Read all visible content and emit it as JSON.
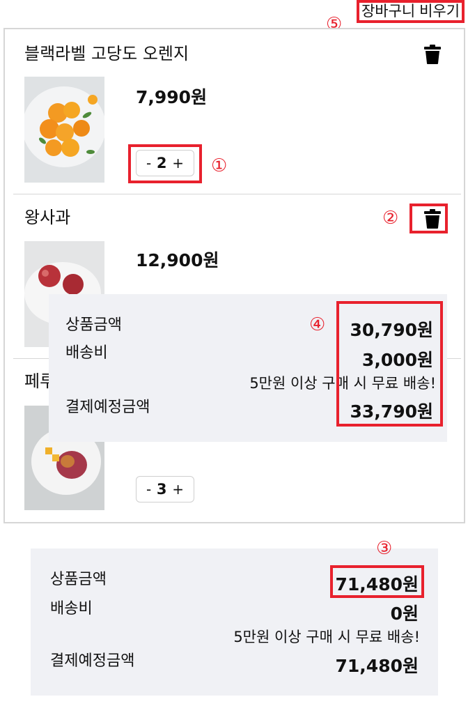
{
  "header": {
    "clear_cart_label": "장바구니 비우기"
  },
  "annotations": {
    "n1": "①",
    "n2": "②",
    "n3": "③",
    "n4": "④",
    "n5": "⑤"
  },
  "items": [
    {
      "name": "블랙라벨 고당도 오렌지",
      "price": "7,990원",
      "qty": "2",
      "minus": "-",
      "plus": "+"
    },
    {
      "name": "왕사과",
      "price": "12,900원"
    },
    {
      "name": "페루",
      "qty": "3",
      "minus": "-",
      "plus": "+"
    }
  ],
  "popup_summary": {
    "product_label": "상품금액",
    "product_value": "30,790원",
    "shipping_label": "배송비",
    "shipping_value": "3,000원",
    "free_note": "5만원 이상 구매 시 무료 배송!",
    "total_label": "결제예정금액",
    "total_value": "33,790원"
  },
  "bottom_summary": {
    "product_label": "상품금액",
    "product_value": "71,480원",
    "shipping_label": "배송비",
    "shipping_value": "0원",
    "free_note": "5만원 이상 구매 시 무료 배송!",
    "total_label": "결제예정금액",
    "total_value": "71,480원"
  },
  "colors": {
    "highlight": "#e8212d",
    "summary_bg": "#f0f1f5",
    "border": "#d6d6d6"
  },
  "icons": {
    "delete": "trash-icon"
  }
}
